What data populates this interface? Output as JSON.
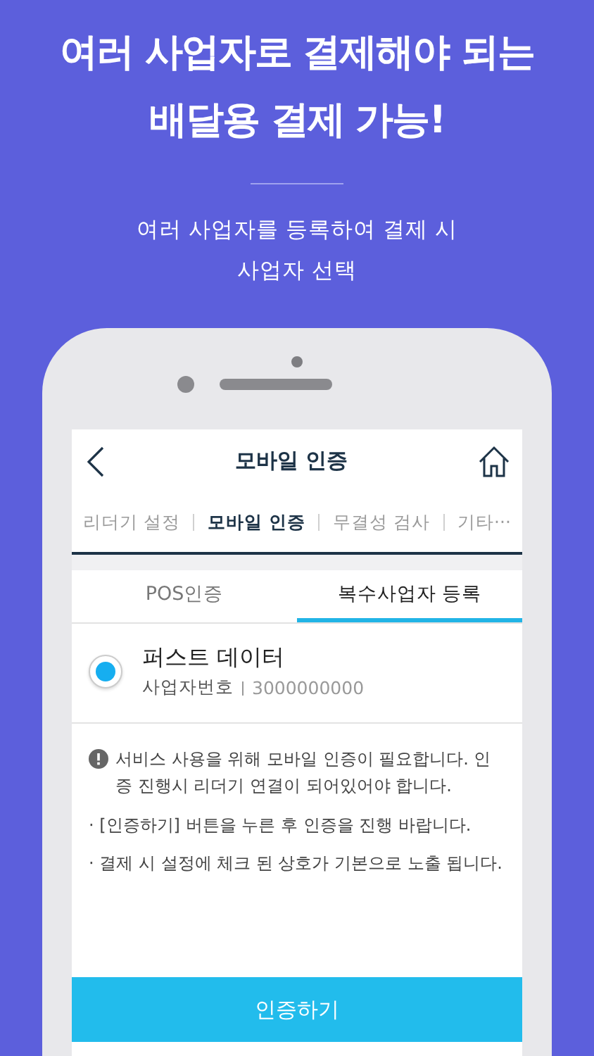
{
  "headline": [
    "여러 사업자로 결제해야 되는",
    "배달용 결제 가능!"
  ],
  "subtitle": [
    "여러 사업자를 등록하여 결제 시",
    "사업자 선택"
  ],
  "screen": {
    "title": "모바일 인증",
    "menu": [
      {
        "label": "리더기 설정",
        "selected": false
      },
      {
        "label": "모바일 인증",
        "selected": true
      },
      {
        "label": "무결성 검사",
        "selected": false
      },
      {
        "label": "기타···",
        "selected": false
      }
    ],
    "tabs": [
      {
        "label": "POS인증",
        "selected": false
      },
      {
        "label": "복수사업자 등록",
        "selected": true
      }
    ],
    "businesses": [
      {
        "name": "퍼스트 데이터",
        "number_label": "사업자번호",
        "number": "3000000000",
        "selected": true
      }
    ],
    "notice": "서비스 사용을 위해 모바일 인증이 필요합니다. 인증 진행시 리더기 연결이 되어있어야 합니다.",
    "bullets": [
      "· [인증하기] 버튼을 누른 후 인증을 진행 바랍니다.",
      "· 결제 시 설정에 체크 된 상호가 기본으로 노출 됩니다."
    ],
    "button": "인증하기"
  }
}
